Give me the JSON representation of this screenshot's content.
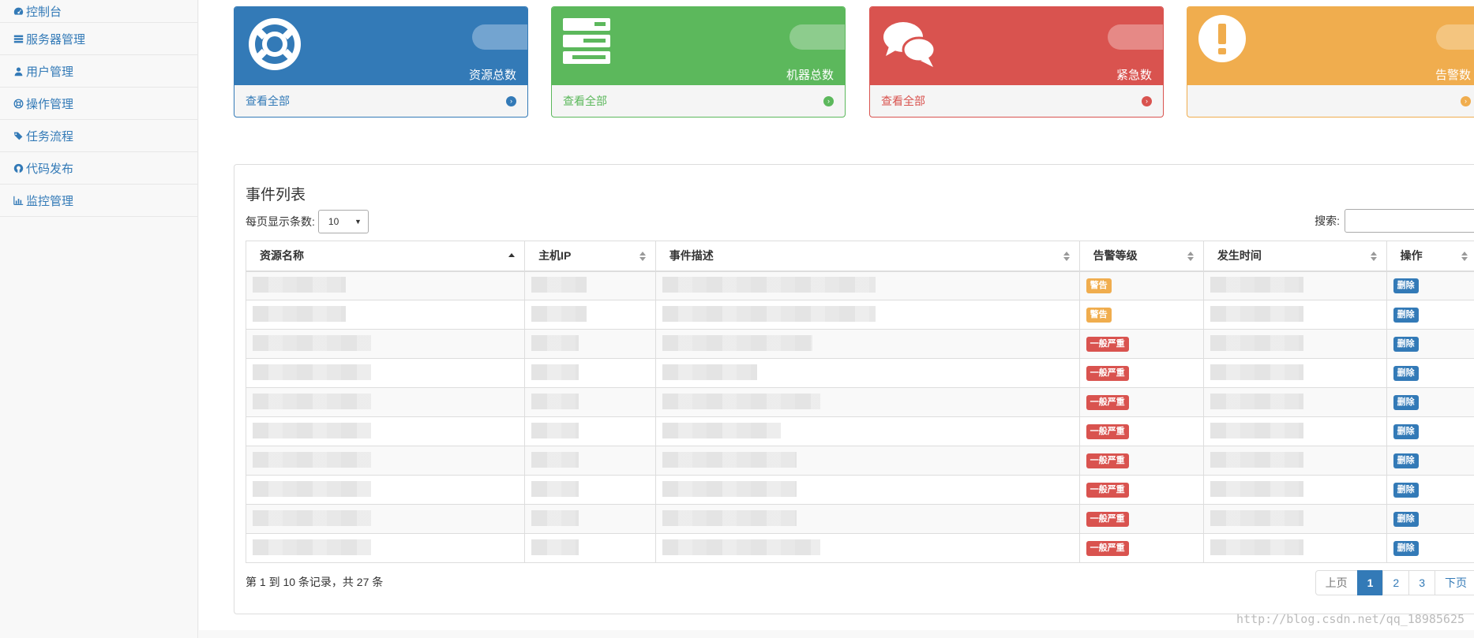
{
  "sidebar": {
    "items": [
      {
        "label": "控制台",
        "icon": "dashboard-icon"
      },
      {
        "label": "服务器管理",
        "icon": "server-icon"
      },
      {
        "label": "用户管理",
        "icon": "user-icon"
      },
      {
        "label": "操作管理",
        "icon": "lifebuoy-icon"
      },
      {
        "label": "任务流程",
        "icon": "tags-icon"
      },
      {
        "label": "代码发布",
        "icon": "github-icon"
      },
      {
        "label": "监控管理",
        "icon": "bar-chart-icon"
      }
    ]
  },
  "panels": [
    {
      "label": "资源总数",
      "footer": "查看全部",
      "icon": "lifebuoy-icon",
      "color": "#337ab7"
    },
    {
      "label": "机器总数",
      "footer": "查看全部",
      "icon": "server-icon",
      "color": "#5cb85c"
    },
    {
      "label": "紧急数",
      "footer": "查看全部",
      "icon": "comments-icon",
      "color": "#d9534f"
    },
    {
      "label": "告警数",
      "footer": "",
      "icon": "exclamation-icon",
      "color": "#f0ad4e"
    }
  ],
  "events": {
    "title": "事件列表",
    "page_length_label": "每页显示条数:",
    "page_length_value": "10",
    "search_label": "搜索:",
    "columns": [
      "资源名称",
      "主机IP",
      "事件描述",
      "告警等级",
      "发生时间",
      "操作"
    ],
    "rows": [
      {
        "level": "警告",
        "level_type": "warn",
        "action": "删除"
      },
      {
        "level": "警告",
        "level_type": "warn",
        "action": "删除"
      },
      {
        "level": "一般严重",
        "level_type": "danger",
        "action": "删除"
      },
      {
        "level": "一般严重",
        "level_type": "danger",
        "action": "删除"
      },
      {
        "level": "一般严重",
        "level_type": "danger",
        "action": "删除"
      },
      {
        "level": "一般严重",
        "level_type": "danger",
        "action": "删除"
      },
      {
        "level": "一般严重",
        "level_type": "danger",
        "action": "删除"
      },
      {
        "level": "一般严重",
        "level_type": "danger",
        "action": "删除"
      },
      {
        "level": "一般严重",
        "level_type": "danger",
        "action": "删除"
      },
      {
        "level": "一般严重",
        "level_type": "danger",
        "action": "删除"
      }
    ],
    "info": "第 1 到 10 条记录，共 27 条",
    "pagination": {
      "prev": "上页",
      "pages": [
        "1",
        "2",
        "3"
      ],
      "active": "1",
      "next": "下页"
    }
  },
  "watermark": "http://blog.csdn.net/qq_18985625"
}
